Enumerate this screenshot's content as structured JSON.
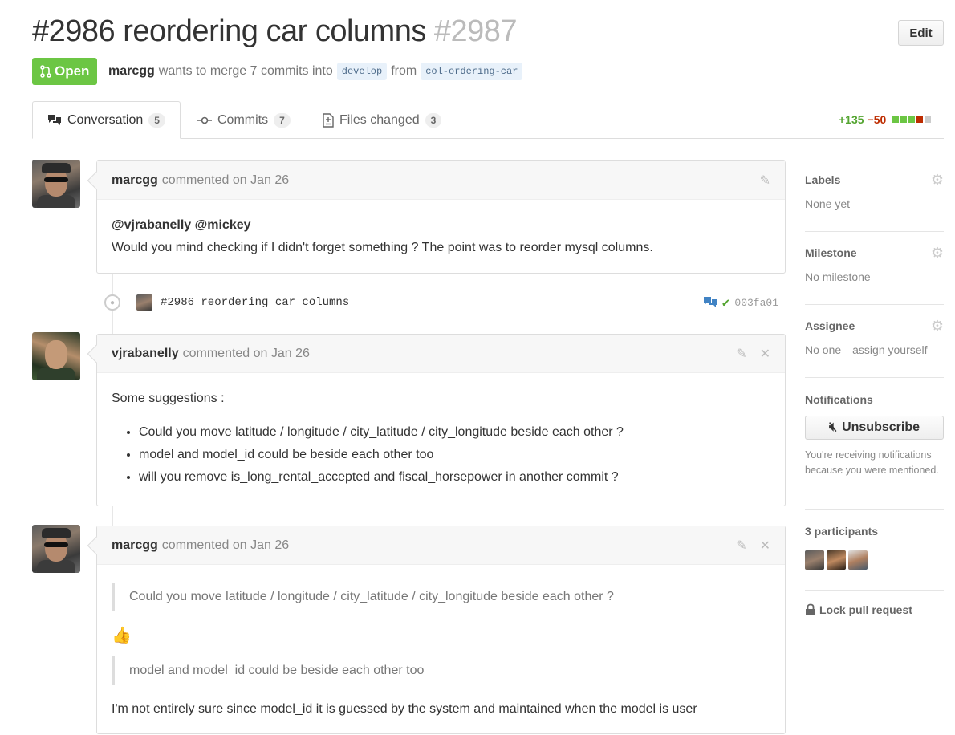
{
  "header": {
    "title": "#2986 reordering car columns",
    "number": "#2987",
    "edit_label": "Edit",
    "state": "Open",
    "author": "marcgg",
    "merge_text": "wants to merge 7 commits into",
    "base_branch": "develop",
    "from_text": "from",
    "head_branch": "col-ordering-car"
  },
  "tabs": [
    {
      "label": "Conversation",
      "count": "5"
    },
    {
      "label": "Commits",
      "count": "7"
    },
    {
      "label": "Files changed",
      "count": "3"
    }
  ],
  "diffstat": {
    "additions": "+135",
    "deletions": "−50"
  },
  "comments": [
    {
      "author": "marcgg",
      "date": "commented on Jan 26",
      "mentions": "@vjrabanelly @mickey",
      "text": "Would you mind checking if I didn't forget something ? The point was to reorder mysql columns."
    },
    {
      "author": "vjrabanelly",
      "date": "commented on Jan 26",
      "intro": "Some suggestions :",
      "items": [
        "Could you move latitude / longitude / city_latitude / city_longitude beside each other ?",
        "model and model_id could be beside each other too",
        "will you remove is_long_rental_accepted and fiscal_horsepower in another commit ?"
      ]
    },
    {
      "author": "marcgg",
      "date": "commented on Jan 26",
      "quote1": "Could you move latitude / longitude / city_latitude / city_longitude beside each other ?",
      "emoji": "👍",
      "quote2": "model and model_id could be beside each other too",
      "text": "I'm not entirely sure since model_id it is guessed by the system and maintained when the model is user"
    }
  ],
  "commit": {
    "message": "#2986 reordering car columns",
    "sha": "003fa01"
  },
  "sidebar": {
    "labels_title": "Labels",
    "labels_value": "None yet",
    "milestone_title": "Milestone",
    "milestone_value": "No milestone",
    "assignee_title": "Assignee",
    "assignee_value": "No one—assign yourself",
    "notifications_title": "Notifications",
    "unsubscribe_label": "Unsubscribe",
    "notifications_note": "You're receiving notifications because you were mentioned.",
    "participants_title": "3 participants",
    "lock_label": "Lock pull request"
  },
  "colors": {
    "open_green": "#6cc644",
    "add_green": "#55a532",
    "del_red": "#bd2c00"
  }
}
